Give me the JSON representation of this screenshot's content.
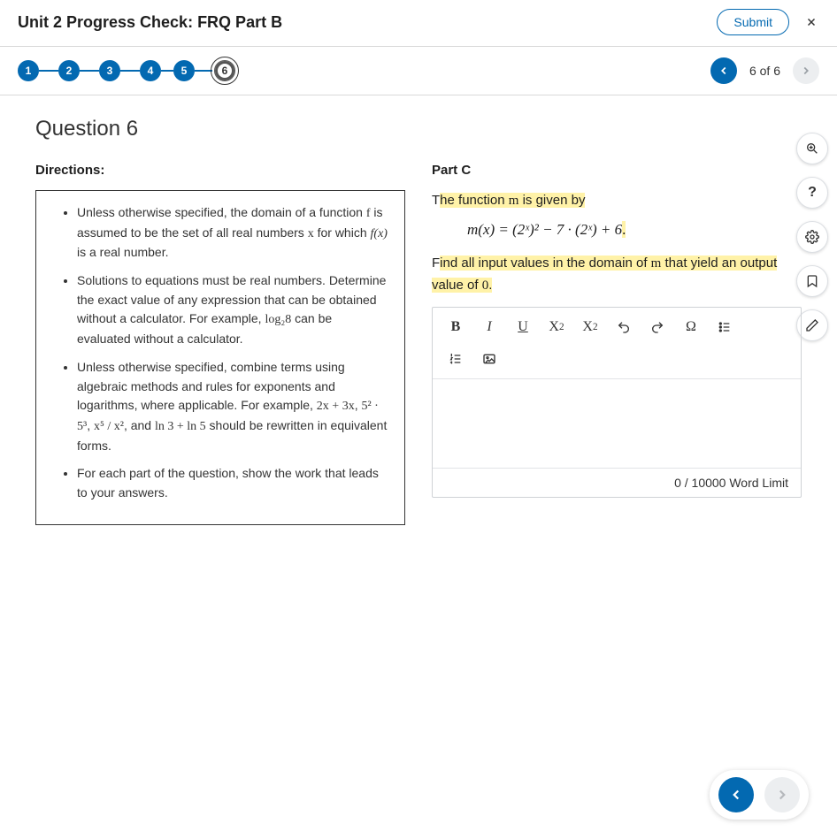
{
  "header": {
    "title": "Unit 2 Progress Check: FRQ Part B",
    "submit_label": "Submit"
  },
  "nav": {
    "steps": [
      "1",
      "2",
      "3",
      "4",
      "5",
      "6"
    ],
    "current_index": 5,
    "counter": "6 of 6"
  },
  "question": {
    "title": "Question 6",
    "directions_label": "Directions:",
    "directions": {
      "item1_pre": "Unless otherwise specified, the domain of a function ",
      "item1_f": "f",
      "item1_mid": " is assumed to be the set of all real numbers ",
      "item1_x": "x",
      "item1_mid2": " for which ",
      "item1_fx": "f(x)",
      "item1_post": " is a real number.",
      "item2_pre": "Solutions to equations must be real numbers. Determine the exact value of any expression that can be obtained without a calculator. For example, ",
      "item2_expr": "log₂8",
      "item2_post": " can be evaluated without a calculator.",
      "item3_pre": "Unless otherwise specified, combine terms using algebraic methods and rules for exponents and logarithms, where applicable. For example, ",
      "item3_e1": "2x + 3x",
      "item3_c1": ", ",
      "item3_e2": "5² · 5³",
      "item3_c2": ", ",
      "item3_e3": "x⁵ / x²",
      "item3_c3": ", and ",
      "item3_e4": "ln 3 + ln 5",
      "item3_post": " should be rewritten in equivalent forms.",
      "item4": "For each part of the question, show the work that leads to your answers."
    },
    "part": {
      "label": "Part C",
      "line1_pre": "T",
      "line1_hl": "he function ",
      "line1_m": "m",
      "line1_post_hl": " is given by",
      "equation": "m(x) = (2ˣ)² − 7 · (2ˣ) + 6",
      "equation_end_hl": ".",
      "line2_pre": "F",
      "line2_hl_a": "ind all input values in the domain of ",
      "line2_m": "m",
      "line2_hl_b": " that yield an output value of ",
      "line2_zero": "0",
      "line2_end": "."
    }
  },
  "editor": {
    "toolbar": {
      "bold": "B",
      "italic": "I",
      "underline": "U",
      "sup": "X",
      "sub": "X",
      "omega": "Ω"
    },
    "word_count": "0",
    "limit_label": " / 10000 Word Limit"
  },
  "rail": {
    "help": "?"
  }
}
